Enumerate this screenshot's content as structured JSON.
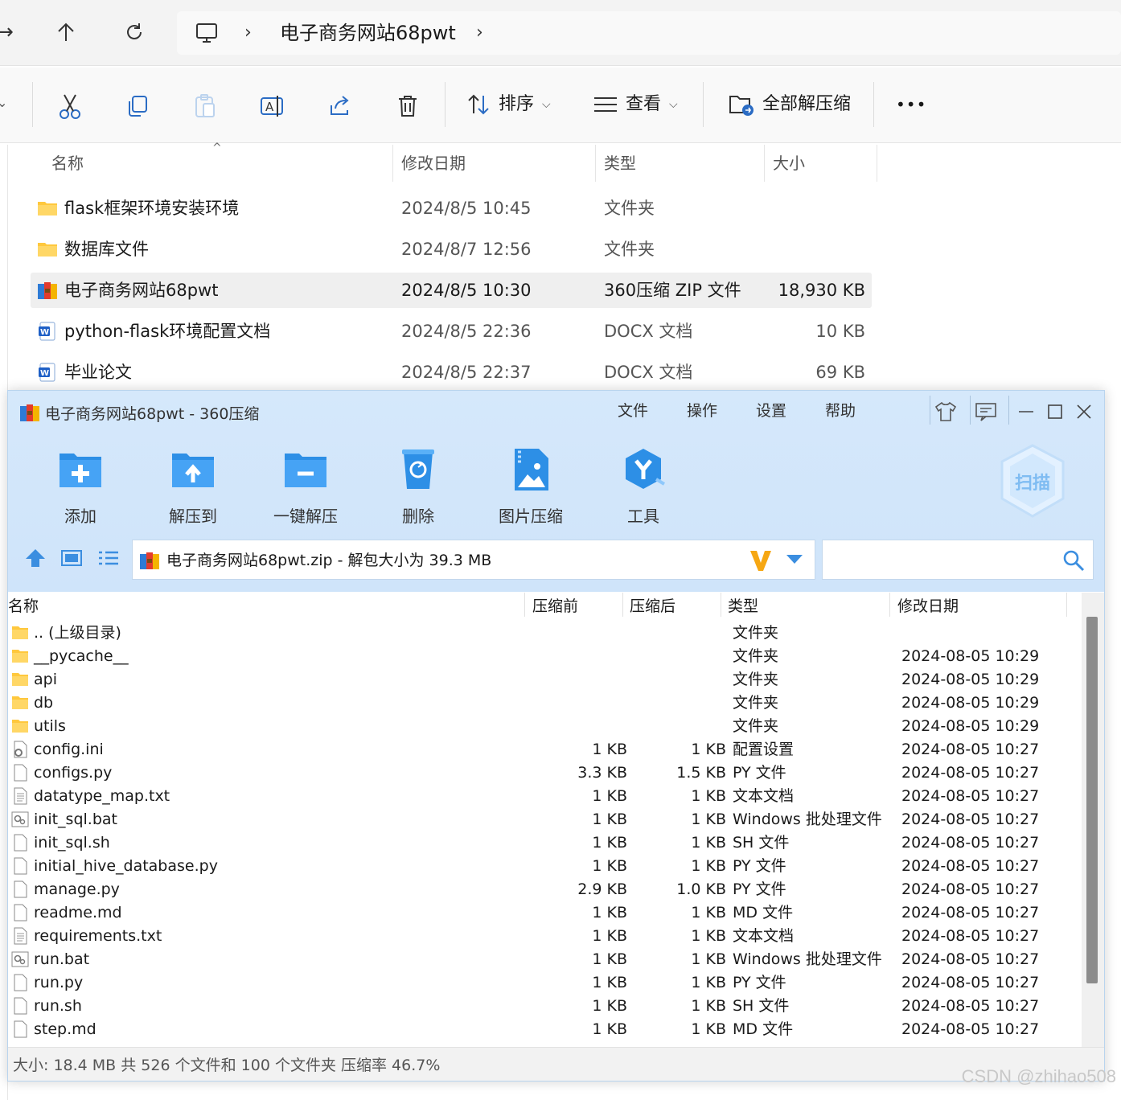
{
  "explorer": {
    "breadcrumb": [
      "电子商务网站68pwt"
    ],
    "toolbar": {
      "sort_label": "排序",
      "view_label": "查看",
      "extract_all_label": "全部解压缩",
      "more_label": "•••"
    },
    "columns": [
      "名称",
      "修改日期",
      "类型",
      "大小"
    ],
    "rows": [
      {
        "name": "flask框架环境安装环境",
        "date": "2024/8/5 10:45",
        "type": "文件夹",
        "size": "",
        "icon": "folder-icon"
      },
      {
        "name": "数据库文件",
        "date": "2024/8/7 12:56",
        "type": "文件夹",
        "size": "",
        "icon": "folder-icon"
      },
      {
        "name": "电子商务网站68pwt",
        "date": "2024/8/5 10:30",
        "type": "360压缩 ZIP 文件",
        "size": "18,930 KB",
        "icon": "zip-archive-icon",
        "selected": true
      },
      {
        "name": "python-flask环境配置文档",
        "date": "2024/8/5 22:36",
        "type": "DOCX 文档",
        "size": "10 KB",
        "icon": "word-doc-icon"
      },
      {
        "name": "毕业论文",
        "date": "2024/8/5 22:37",
        "type": "DOCX 文档",
        "size": "69 KB",
        "icon": "word-doc-icon"
      }
    ]
  },
  "zip": {
    "title": "电子商务网站68pwt - 360压缩",
    "menu": [
      "文件",
      "操作",
      "设置",
      "帮助"
    ],
    "actions": [
      "添加",
      "解压到",
      "一键解压",
      "删除",
      "图片压缩",
      "工具"
    ],
    "scan_label": "扫描",
    "path": "电子商务网站68pwt.zip - 解包大小为 39.3 MB",
    "columns": [
      "名称",
      "压缩前",
      "压缩后",
      "类型",
      "修改日期"
    ],
    "rows": [
      {
        "name": ".. (上级目录)",
        "before": "",
        "after": "",
        "type": "文件夹",
        "date": "",
        "icon": "folder-icon"
      },
      {
        "name": "__pycache__",
        "before": "",
        "after": "",
        "type": "文件夹",
        "date": "2024-08-05 10:29",
        "icon": "folder-icon"
      },
      {
        "name": "api",
        "before": "",
        "after": "",
        "type": "文件夹",
        "date": "2024-08-05 10:29",
        "icon": "folder-icon"
      },
      {
        "name": "db",
        "before": "",
        "after": "",
        "type": "文件夹",
        "date": "2024-08-05 10:29",
        "icon": "folder-icon"
      },
      {
        "name": "utils",
        "before": "",
        "after": "",
        "type": "文件夹",
        "date": "2024-08-05 10:29",
        "icon": "folder-icon"
      },
      {
        "name": "config.ini",
        "before": "1 KB",
        "after": "1 KB",
        "type": "配置设置",
        "date": "2024-08-05 10:27",
        "icon": "settings-file-icon"
      },
      {
        "name": "configs.py",
        "before": "3.3 KB",
        "after": "1.5 KB",
        "type": "PY 文件",
        "date": "2024-08-05 10:27",
        "icon": "file-icon"
      },
      {
        "name": "datatype_map.txt",
        "before": "1 KB",
        "after": "1 KB",
        "type": "文本文档",
        "date": "2024-08-05 10:27",
        "icon": "text-file-icon"
      },
      {
        "name": "init_sql.bat",
        "before": "1 KB",
        "after": "1 KB",
        "type": "Windows 批处理文件",
        "date": "2024-08-05 10:27",
        "icon": "batch-file-icon"
      },
      {
        "name": "init_sql.sh",
        "before": "1 KB",
        "after": "1 KB",
        "type": "SH 文件",
        "date": "2024-08-05 10:27",
        "icon": "file-icon"
      },
      {
        "name": "initial_hive_database.py",
        "before": "1 KB",
        "after": "1 KB",
        "type": "PY 文件",
        "date": "2024-08-05 10:27",
        "icon": "file-icon"
      },
      {
        "name": "manage.py",
        "before": "2.9 KB",
        "after": "1.0 KB",
        "type": "PY 文件",
        "date": "2024-08-05 10:27",
        "icon": "file-icon"
      },
      {
        "name": "readme.md",
        "before": "1 KB",
        "after": "1 KB",
        "type": "MD 文件",
        "date": "2024-08-05 10:27",
        "icon": "file-icon"
      },
      {
        "name": "requirements.txt",
        "before": "1 KB",
        "after": "1 KB",
        "type": "文本文档",
        "date": "2024-08-05 10:27",
        "icon": "text-file-icon"
      },
      {
        "name": "run.bat",
        "before": "1 KB",
        "after": "1 KB",
        "type": "Windows 批处理文件",
        "date": "2024-08-05 10:27",
        "icon": "batch-file-icon"
      },
      {
        "name": "run.py",
        "before": "1 KB",
        "after": "1 KB",
        "type": "PY 文件",
        "date": "2024-08-05 10:27",
        "icon": "file-icon"
      },
      {
        "name": "run.sh",
        "before": "1 KB",
        "after": "1 KB",
        "type": "SH 文件",
        "date": "2024-08-05 10:27",
        "icon": "file-icon"
      },
      {
        "name": "step.md",
        "before": "1 KB",
        "after": "1 KB",
        "type": "MD 文件",
        "date": "2024-08-05 10:27",
        "icon": "file-icon"
      }
    ],
    "status": "大小: 18.4 MB 共 526 个文件和 100 个文件夹 压缩率 46.7%"
  },
  "watermark": "CSDN @zhihao508",
  "colors": {
    "accent": "#2d8fe6",
    "folder": "#ffc83d",
    "zip_bg": "#d5e8fb"
  }
}
